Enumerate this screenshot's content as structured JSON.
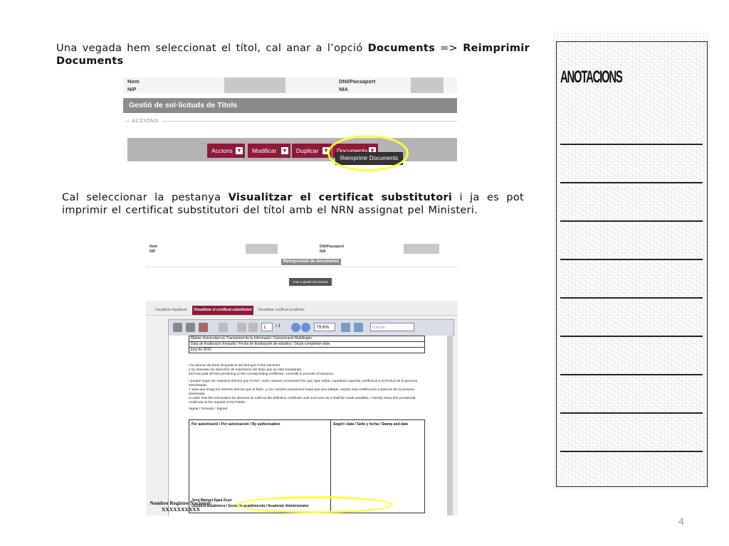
{
  "paragraph1": {
    "text_before": "Una vegada hem seleccionat el títol, cal anar a l’opció ",
    "bold1": "Documents",
    "text_mid": " => ",
    "bold2": "Reimprimir Documents"
  },
  "paragraph2": {
    "text_before": "Cal seleccionar la pestanya ",
    "bold": "Visualitzar el certificat substitutori",
    "text_after": " i ja es pot imprimir el certificat substitutori del títol amb el NRN assignat pel Ministeri."
  },
  "screenshot1": {
    "label_nom": "Nom",
    "label_nip": "NIP",
    "label_dni": "DNI/Passaport",
    "label_nia": "NIA",
    "title": "Gestió de sol·licituds de Títols",
    "accions_label": "— ACCIONS",
    "buttons": [
      "Accions",
      "Modificar",
      "Duplicar",
      "Documents"
    ],
    "dropdown_item": "Reimprimir Documents",
    "highlight_color": "#ffff33",
    "button_color": "#8e1a3a"
  },
  "screenshot2": {
    "label_nom": "Nom",
    "label_nip": "NIP",
    "label_dni": "DNI/Passaport",
    "label_nia": "NIA",
    "title": "Reimpressió de documents",
    "back_button": "Anar a gestió del alumne",
    "tabs": [
      "Visualitzar liquidació",
      "Visualitzar el certificat substitutori",
      "Visualitzar certificat acadèmic"
    ],
    "active_tab": 1,
    "toolbar": {
      "page": "1",
      "page_total": "/ 1",
      "zoom": "79,6%",
      "search_placeholder": "Cerca"
    },
    "doc_rows": [
      "Màster Universitari en Tractament de la Informació i Comunicació Multilingüe",
      "Data de finalització d'estudis / Fecha de finalización de estudios / Study-completion date",
      "juny de 2010"
    ],
    "doc_paragraphs": [
      "i ha abonat els drets d'expedició del títol que s'està tramitant.",
      "y ha abonado los derechos de expedición del título que se está tramitando.",
      "and has paid all fees pertaining to the corresponding certificate, currently in process of issuance.",
      "I perquè tingui els mateixos efectes que el títol, i amb caràcter provisional fins que sigui editat, expedeixo aquesta certificació a sol·licitud de la persona interessada.",
      "Y para que tenga los mismos efectos que el título, y con carácter provisional hasta que sea editado, expido esta certificación a petición de la persona interesada.",
      "In order that this information be deemed as valid as the definitive certificate until such time as it shall be made available, I hereby issue this provisional certificate at the request of the holder.",
      "Signat / Firmado / Signed"
    ],
    "sign_left": "Per autorització / Por autorización / By authorisation",
    "sign_right": "Segell i data / Sello y fecha / Stamp and date",
    "signer_name": "José Manuel Egea Zoyo",
    "signer_role": "Gestoria acadèmica / Gestoría académicola / Academic Administrator",
    "nrn": "Nombre Registre Nacional: XXXXXXXXXX"
  },
  "sidebar": {
    "title": "ANOTACIONS",
    "line_count": 9
  },
  "page_number": "4"
}
